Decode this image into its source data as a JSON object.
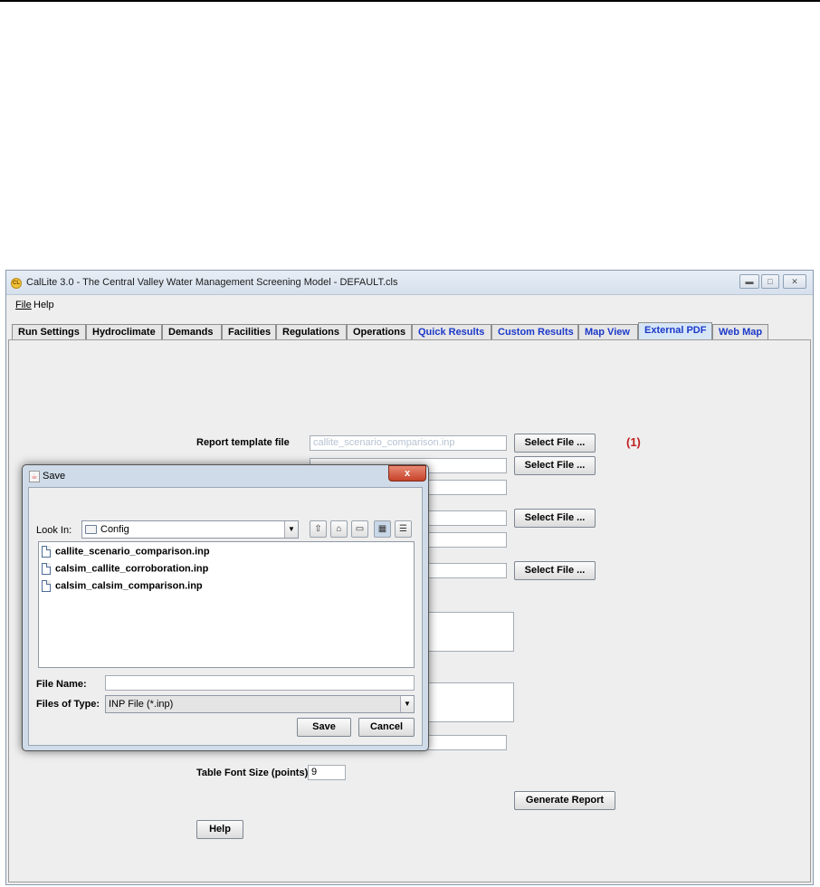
{
  "window": {
    "title": "CalLite 3.0 -  The Central Valley Water Management Screening Model - DEFAULT.cls",
    "app_icon": "CL",
    "controls": [
      "minimize-icon",
      "maximize-icon",
      "close-icon"
    ]
  },
  "menu": {
    "file": "File",
    "help": "Help"
  },
  "tabs": [
    {
      "label": "Run Settings"
    },
    {
      "label": "Hydroclimate"
    },
    {
      "label": "Demands"
    },
    {
      "label": "Facilities"
    },
    {
      "label": "Regulations"
    },
    {
      "label": "Operations"
    },
    {
      "label": "Quick Results"
    },
    {
      "label": "Custom Results"
    },
    {
      "label": "Map View"
    },
    {
      "label": "External PDF"
    },
    {
      "label": "Web Map"
    }
  ],
  "selected_tab": "External PDF",
  "form": {
    "report_template_label": "Report template file",
    "report_template_value": "callite_scenario_comparison.inp",
    "select_file": "Select File ...",
    "annotation": "(1)",
    "table_font_label": "Table Font Size (points)",
    "table_font_value": "9",
    "generate_report": "Generate Report",
    "help": "Help"
  },
  "dialog": {
    "title": "Save",
    "close": "x",
    "look_in_label": "Look In:",
    "look_in_value": "Config",
    "toolbar_icons": [
      "up-folder-icon",
      "home-icon",
      "new-folder-icon",
      "list-view-icon",
      "details-view-icon"
    ],
    "files": [
      "callite_scenario_comparison.inp",
      "calsim_callite_corroboration.inp",
      "calsim_calsim_comparison.inp"
    ],
    "file_name_label": "File Name:",
    "file_name_value": "",
    "files_of_type_label": "Files of Type:",
    "files_of_type_value": "INP File (*.inp)",
    "save": "Save",
    "cancel": "Cancel"
  },
  "colors": {
    "tab_link": "#1c39c9",
    "annotation": "#c0201f",
    "selected_tab": "#d6e6f6"
  }
}
